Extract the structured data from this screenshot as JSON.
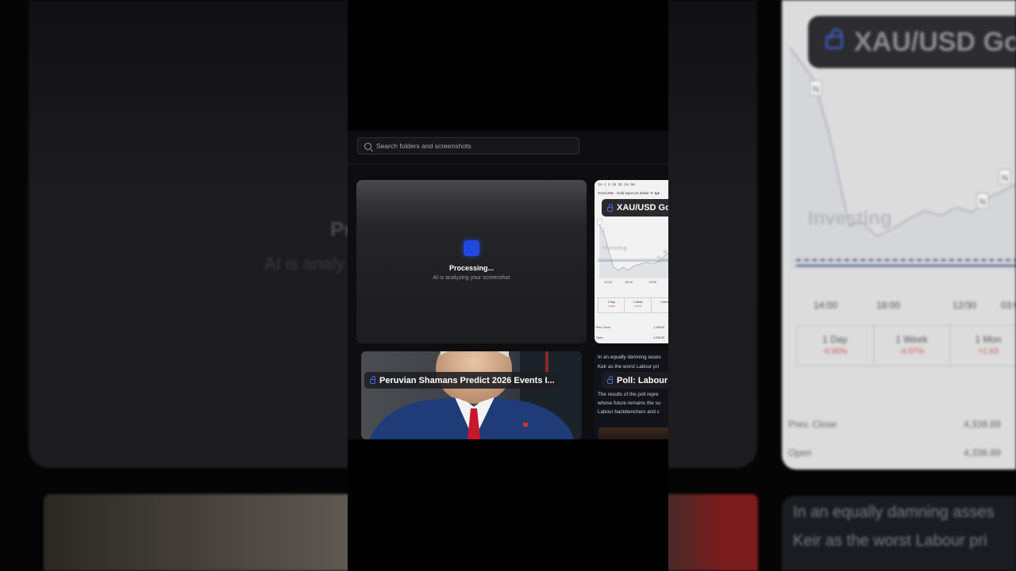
{
  "search": {
    "placeholder": "Search folders and screenshots"
  },
  "processing_card": {
    "title": "Processing...",
    "subtitle": "AI is analyzing your screenshot"
  },
  "chart_card": {
    "title": "XAU/USD Go",
    "header_text": "XAU/USD - Gold Spot US Dollar",
    "price": "4,2",
    "watermark": "Investing",
    "times": [
      "14:00",
      "18:00",
      "12/30"
    ],
    "periods": [
      {
        "label": "1 Day",
        "change": "-0.90%"
      },
      {
        "label": "1 Week",
        "change": "-4.07%"
      },
      {
        "label": "1 Mon",
        "change": ""
      }
    ],
    "prev_close_label": "Prev. Close",
    "prev_close_value": "4,338.89",
    "open_label": "Open",
    "open_value": "4,336.89"
  },
  "photo_card": {
    "title": "Peruvian Shamans Predict 2026 Events I..."
  },
  "text_card": {
    "title": "Poll: Labour",
    "lines": [
      "In an equally damning asses",
      "Keir as the worst Labour pri",
      "The results of the poll repre",
      "whose future remains the su",
      "Labour backbenchers and c"
    ]
  },
  "background": {
    "processing_title": "Pr",
    "processing_sub": "AI is analy",
    "chart_title": "XAU/USD Go",
    "watermark": "Investing",
    "times": [
      "14:00",
      "18:00",
      "12/30",
      "03:0"
    ],
    "periods": [
      {
        "label": "1 Day",
        "change": "-0.90%"
      },
      {
        "label": "1 Week",
        "change": "-4.07%"
      },
      {
        "label": "1 Mon",
        "change": "+1.63"
      }
    ],
    "prev_close_label": "Prev. Close",
    "prev_close_value": "4,338.89",
    "open_label": "Open",
    "open_value": "4,336.89",
    "text_lines": [
      "In an equally damning asses",
      "Keir as the worst Labour pri"
    ]
  },
  "colors": {
    "accent": "#2149e0",
    "panel_bg": "#0e0e10",
    "page_bg": "#050505"
  }
}
